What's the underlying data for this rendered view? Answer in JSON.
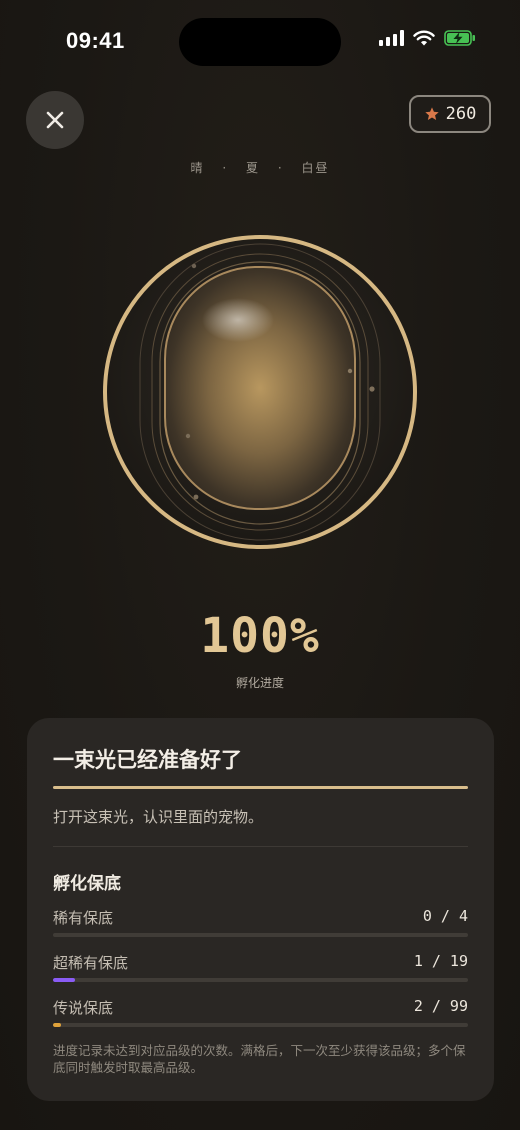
{
  "status_bar": {
    "time": "09:41",
    "icons": [
      "signal-icon",
      "wifi-icon",
      "battery-charging-icon"
    ]
  },
  "header": {
    "close_icon": "close-icon",
    "coin_icon": "star-icon",
    "coin_count": "260",
    "env": [
      "晴",
      "夏",
      "白昼"
    ],
    "env_separator": "·"
  },
  "progress": {
    "percent_text": "100%",
    "value": 1.0,
    "label": "孵化进度"
  },
  "card": {
    "title": "一束光已经准备好了",
    "description": "打开这束光，认识里面的宠物。",
    "pity_title": "孵化保底",
    "pity_rows": [
      {
        "label": "稀有保底",
        "value_text": "0 / 4",
        "current": 0,
        "max": 4,
        "color": "#8a6cf0"
      },
      {
        "label": "超稀有保底",
        "value_text": "1 / 19",
        "current": 1,
        "max": 19,
        "color": "#8a5cf5"
      },
      {
        "label": "传说保底",
        "value_text": "2 / 99",
        "current": 2,
        "max": 99,
        "color": "#e0a23a"
      }
    ],
    "note": "进度记录未达到对应品级的次数。满格后，下一次至少获得该品级；多个保底同时触发时取最高品级。"
  },
  "colors": {
    "accent_gold": "#d9be8c",
    "percent_gold": "#e2c795",
    "card_bg": "#2a2724",
    "coin_star": "#d9794a"
  }
}
